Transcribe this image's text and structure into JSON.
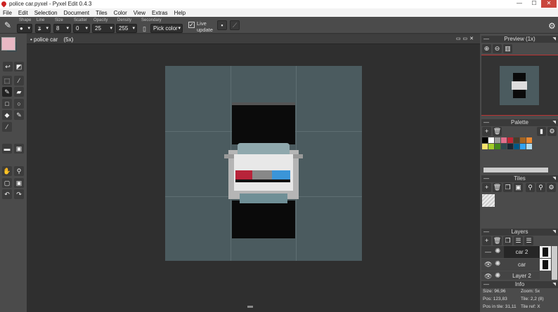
{
  "window": {
    "title": "police car.pyxel - Pyxel Edit 0.4.3",
    "min": "—",
    "max": "☐",
    "close": "✕"
  },
  "menu": [
    "File",
    "Edit",
    "Selection",
    "Document",
    "Tiles",
    "Color",
    "View",
    "Extras",
    "Help"
  ],
  "toolbar": {
    "shape_label": "Shape",
    "line_label": "Line",
    "size_label": "Size",
    "size": "8",
    "scatter_label": "Scatter",
    "scatter": "0",
    "opacity_label": "Opacity",
    "opacity": "25",
    "density_label": "Density",
    "density": "255",
    "secondary_label": "Secondary",
    "secondary": "Pick color",
    "live_update": "Live update"
  },
  "colors": {
    "primary": "#e9b8c4",
    "secondary": "#3d4a4e"
  },
  "document": {
    "tab": "• police car",
    "zoom": "(5x)"
  },
  "preview": {
    "title": "Preview (1x)"
  },
  "palette": {
    "title": "Palette",
    "swatches": [
      "#000000",
      "#ffffff",
      "#9d9d9d",
      "#e06f8b",
      "#be2633",
      "#493c2b",
      "#a46422",
      "#eb8931",
      "#f7e26b",
      "#a3ce27",
      "#44891a",
      "#2f484e",
      "#1b2632",
      "#005784",
      "#31a2f2",
      "#b2dcef"
    ]
  },
  "tiles": {
    "title": "Tiles"
  },
  "layers": {
    "title": "Layers",
    "items": [
      {
        "name": "car 2",
        "selected": true
      },
      {
        "name": "car",
        "selected": false
      },
      {
        "name": "Layer 2",
        "selected": false
      }
    ]
  },
  "info": {
    "title": "Info",
    "size": "Size: 96,96",
    "zoom": "Zoom: 5x",
    "pos": "Pos: 123,83",
    "tile": "Tile: 2,2 (8)",
    "pos_in_tile": "Pos in tile: 31,11",
    "tile_ref": "Tile ref: X"
  }
}
